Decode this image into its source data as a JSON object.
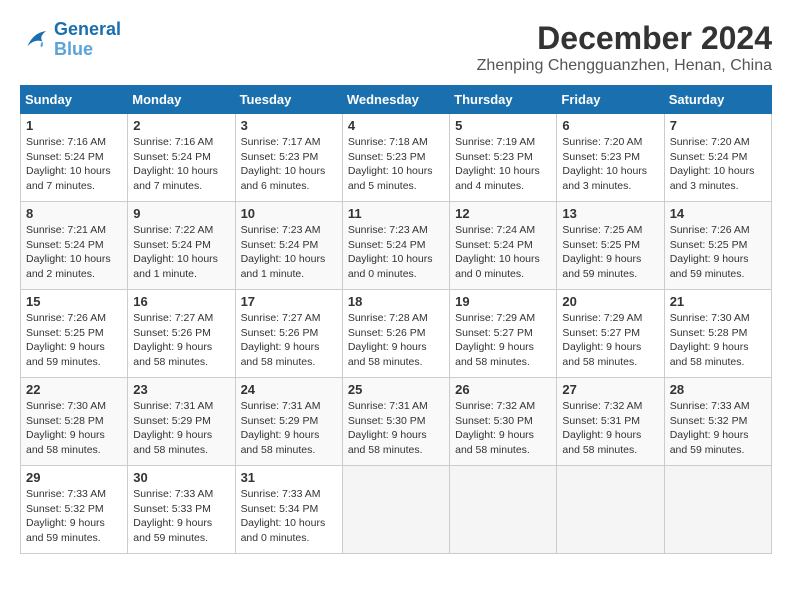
{
  "logo": {
    "line1": "General",
    "line2": "Blue"
  },
  "title": {
    "month_year": "December 2024",
    "location": "Zhenping Chengguanzhen, Henan, China"
  },
  "headers": [
    "Sunday",
    "Monday",
    "Tuesday",
    "Wednesday",
    "Thursday",
    "Friday",
    "Saturday"
  ],
  "weeks": [
    [
      {
        "day": "1",
        "sunrise": "7:16 AM",
        "sunset": "5:24 PM",
        "daylight": "10 hours and 7 minutes."
      },
      {
        "day": "2",
        "sunrise": "7:16 AM",
        "sunset": "5:24 PM",
        "daylight": "10 hours and 7 minutes."
      },
      {
        "day": "3",
        "sunrise": "7:17 AM",
        "sunset": "5:23 PM",
        "daylight": "10 hours and 6 minutes."
      },
      {
        "day": "4",
        "sunrise": "7:18 AM",
        "sunset": "5:23 PM",
        "daylight": "10 hours and 5 minutes."
      },
      {
        "day": "5",
        "sunrise": "7:19 AM",
        "sunset": "5:23 PM",
        "daylight": "10 hours and 4 minutes."
      },
      {
        "day": "6",
        "sunrise": "7:20 AM",
        "sunset": "5:23 PM",
        "daylight": "10 hours and 3 minutes."
      },
      {
        "day": "7",
        "sunrise": "7:20 AM",
        "sunset": "5:24 PM",
        "daylight": "10 hours and 3 minutes."
      }
    ],
    [
      {
        "day": "8",
        "sunrise": "7:21 AM",
        "sunset": "5:24 PM",
        "daylight": "10 hours and 2 minutes."
      },
      {
        "day": "9",
        "sunrise": "7:22 AM",
        "sunset": "5:24 PM",
        "daylight": "10 hours and 1 minute."
      },
      {
        "day": "10",
        "sunrise": "7:23 AM",
        "sunset": "5:24 PM",
        "daylight": "10 hours and 1 minute."
      },
      {
        "day": "11",
        "sunrise": "7:23 AM",
        "sunset": "5:24 PM",
        "daylight": "10 hours and 0 minutes."
      },
      {
        "day": "12",
        "sunrise": "7:24 AM",
        "sunset": "5:24 PM",
        "daylight": "10 hours and 0 minutes."
      },
      {
        "day": "13",
        "sunrise": "7:25 AM",
        "sunset": "5:25 PM",
        "daylight": "9 hours and 59 minutes."
      },
      {
        "day": "14",
        "sunrise": "7:26 AM",
        "sunset": "5:25 PM",
        "daylight": "9 hours and 59 minutes."
      }
    ],
    [
      {
        "day": "15",
        "sunrise": "7:26 AM",
        "sunset": "5:25 PM",
        "daylight": "9 hours and 59 minutes."
      },
      {
        "day": "16",
        "sunrise": "7:27 AM",
        "sunset": "5:26 PM",
        "daylight": "9 hours and 58 minutes."
      },
      {
        "day": "17",
        "sunrise": "7:27 AM",
        "sunset": "5:26 PM",
        "daylight": "9 hours and 58 minutes."
      },
      {
        "day": "18",
        "sunrise": "7:28 AM",
        "sunset": "5:26 PM",
        "daylight": "9 hours and 58 minutes."
      },
      {
        "day": "19",
        "sunrise": "7:29 AM",
        "sunset": "5:27 PM",
        "daylight": "9 hours and 58 minutes."
      },
      {
        "day": "20",
        "sunrise": "7:29 AM",
        "sunset": "5:27 PM",
        "daylight": "9 hours and 58 minutes."
      },
      {
        "day": "21",
        "sunrise": "7:30 AM",
        "sunset": "5:28 PM",
        "daylight": "9 hours and 58 minutes."
      }
    ],
    [
      {
        "day": "22",
        "sunrise": "7:30 AM",
        "sunset": "5:28 PM",
        "daylight": "9 hours and 58 minutes."
      },
      {
        "day": "23",
        "sunrise": "7:31 AM",
        "sunset": "5:29 PM",
        "daylight": "9 hours and 58 minutes."
      },
      {
        "day": "24",
        "sunrise": "7:31 AM",
        "sunset": "5:29 PM",
        "daylight": "9 hours and 58 minutes."
      },
      {
        "day": "25",
        "sunrise": "7:31 AM",
        "sunset": "5:30 PM",
        "daylight": "9 hours and 58 minutes."
      },
      {
        "day": "26",
        "sunrise": "7:32 AM",
        "sunset": "5:30 PM",
        "daylight": "9 hours and 58 minutes."
      },
      {
        "day": "27",
        "sunrise": "7:32 AM",
        "sunset": "5:31 PM",
        "daylight": "9 hours and 58 minutes."
      },
      {
        "day": "28",
        "sunrise": "7:33 AM",
        "sunset": "5:32 PM",
        "daylight": "9 hours and 59 minutes."
      }
    ],
    [
      {
        "day": "29",
        "sunrise": "7:33 AM",
        "sunset": "5:32 PM",
        "daylight": "9 hours and 59 minutes."
      },
      {
        "day": "30",
        "sunrise": "7:33 AM",
        "sunset": "5:33 PM",
        "daylight": "9 hours and 59 minutes."
      },
      {
        "day": "31",
        "sunrise": "7:33 AM",
        "sunset": "5:34 PM",
        "daylight": "10 hours and 0 minutes."
      },
      null,
      null,
      null,
      null
    ]
  ]
}
